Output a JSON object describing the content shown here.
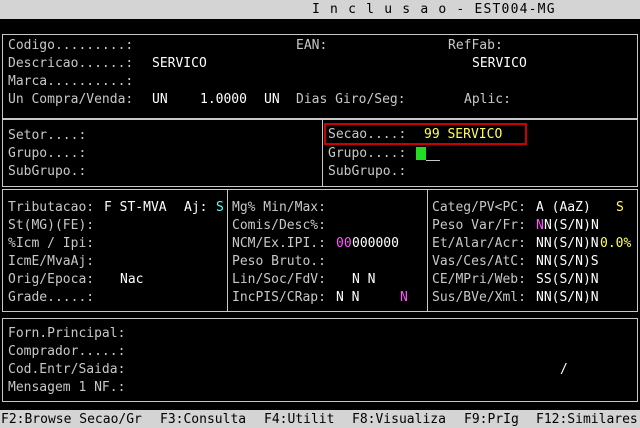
{
  "title": "I n c l u s a o - EST004-MG",
  "section1": {
    "codigo_label": "Codigo.........:",
    "ean_label": "EAN:",
    "reffab_label": "RefFab:",
    "descricao_label": "Descricao......:",
    "descricao_value": "SERVICO",
    "reffab_value": "SERVICO",
    "marca_label": "Marca..........:",
    "uncompra_label": "Un Compra/Venda:",
    "un_compra": "UN",
    "fator": "1.0000",
    "un_venda": "UN",
    "diasgiro_label": "Dias Giro/Seg:",
    "aplic_label": "Aplic:"
  },
  "section2": {
    "setor_label": "Setor....:",
    "grupo_label": "Grupo....:",
    "subgrupo_label": "SubGrupo.:",
    "secao_label": "Secao....:",
    "secao_value": "99 SERVICO",
    "grupo2_label": "Grupo....:",
    "subgrupo2_label": "SubGrupo.:"
  },
  "section3": {
    "tributacao_label": "Tributacao:",
    "tributacao_value": "F ST-MVA",
    "aj_label": "Aj:",
    "aj_value": "S",
    "stmg_label": "St(MG)(FE):",
    "icm_label": "%Icm / Ipi:",
    "icme_label": "IcmE/MvaAj:",
    "orig_label": "Orig/Epoca:",
    "orig_value": "Nac",
    "grade_label": "Grade.....:",
    "mg_label": "Mg% Min/Max:",
    "comis_label": "Comis/Desc%:",
    "ncm_label": "NCM/Ex.IPI.:",
    "ncm_value_a": "00",
    "ncm_value_b": "000000",
    "peso_bruto_label": "Peso Bruto.:",
    "lin_label": "Lin/Soc/FdV:",
    "lin_value": "N N",
    "incpis_label": "IncPIS/CRap:",
    "incpis_value": "N N",
    "incpis_flag": "N",
    "categ_label": "Categ/PV<PC:",
    "categ_value": "A (AaZ)",
    "categ_flag": "S",
    "pesovar_label": "Peso Var/Fr:",
    "pesovar_a": "N",
    "pesovar_b": "N(S/N)N",
    "etalar_label": "Et/Alar/Acr:",
    "etalar_value": "NN(S/N)N",
    "etalar_pct": "0.0%",
    "vasces_label": "Vas/Ces/AtC:",
    "vasces_value": "NN(S/N)S",
    "cempri_label": "CE/MPri/Web:",
    "cempri_value": "SS(S/N)N",
    "susbve_label": "Sus/BVe/Xml:",
    "susbve_value": "NN(S/N)N"
  },
  "section4": {
    "forn_label": "Forn.Principal:",
    "comprador_label": "Comprador.....:",
    "codentr_label": "Cod.Entr/Saida:",
    "codentr_slash": "/",
    "mensagem_label": "Mensagem 1 NF.:"
  },
  "footer": {
    "f2": "F2:Browse Secao/Gr",
    "f3": "F3:Consulta",
    "f4": "F4:Utilit",
    "f8": "F8:Visualiza",
    "f9": "F9:PrIg",
    "f12": "F12:Similares"
  },
  "colors": {
    "background": "#000000",
    "highlight_border": "#cc0000",
    "cursor": "#22dd22",
    "bar": "#d4d4d4"
  }
}
